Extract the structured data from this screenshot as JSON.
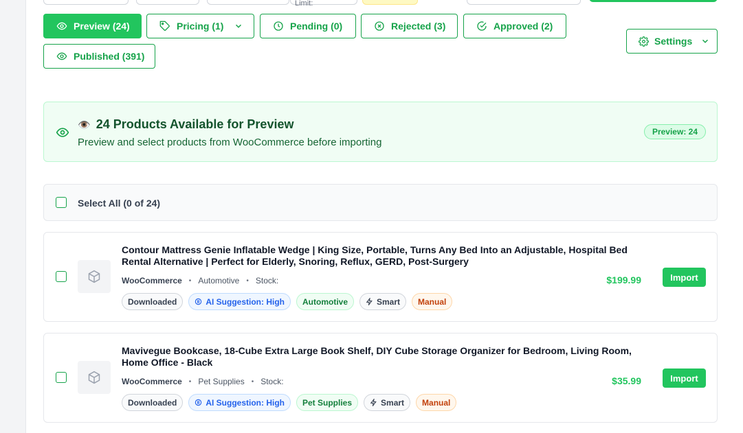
{
  "tabs": [
    {
      "label": "Preview (24)",
      "icon": "eye-icon",
      "active": true
    },
    {
      "label": "Pricing (1)",
      "icon": "tag-icon",
      "dropdown": true
    },
    {
      "label": "Pending (0)",
      "icon": "clock-icon"
    },
    {
      "label": "Rejected (3)",
      "icon": "x-circle-icon"
    },
    {
      "label": "Approved (2)",
      "icon": "check-circle-icon"
    },
    {
      "label": "Published (391)",
      "icon": "eye-icon"
    }
  ],
  "top": {
    "limit_label": "Limit:"
  },
  "settings": {
    "label": "Settings"
  },
  "banner": {
    "emoji": "👁️",
    "title": "24 Products Available for Preview",
    "subtitle": "Preview and select products from WooCommerce before importing",
    "badge": "Preview: 24"
  },
  "select_all": {
    "label": "Select All (0 of 24)"
  },
  "products": [
    {
      "title": "Contour Mattress Genie Inflatable Wedge | King Size, Portable, Turns Any Bed Into an Adjustable, Hospital Bed Rental Alternative | Perfect for Elderly, Snoring, Reflux, GERD, Post-Surgery",
      "source": "WooCommerce",
      "category": "Automotive",
      "stock": "Stock:",
      "price": "$199.99",
      "import_label": "Import",
      "tags": {
        "downloaded": "Downloaded",
        "ai": "AI Suggestion: High",
        "category": "Automotive",
        "smart": "Smart",
        "manual": "Manual"
      }
    },
    {
      "title": "Mavivegue Bookcase, 18-Cube Extra Large Book Shelf, DIY Cube Storage Organizer for Bedroom, Living Room, Home Office - Black",
      "source": "WooCommerce",
      "category": "Pet Supplies",
      "stock": "Stock:",
      "price": "$35.99",
      "import_label": "Import",
      "tags": {
        "downloaded": "Downloaded",
        "ai": "AI Suggestion: High",
        "category": "Pet Supplies",
        "smart": "Smart",
        "manual": "Manual"
      }
    }
  ],
  "colors": {
    "accent": "#22c55e",
    "accent_dark": "#16a34a",
    "banner_bg": "#f0fdf4"
  }
}
